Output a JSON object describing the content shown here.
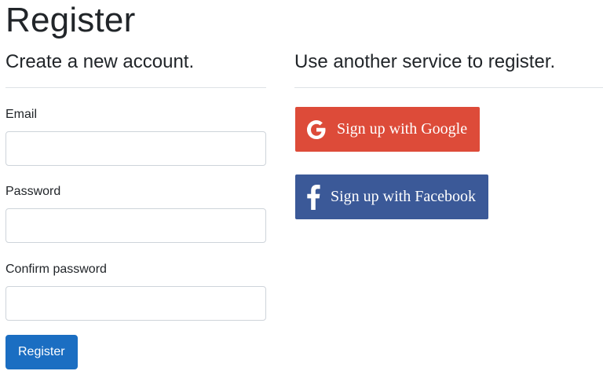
{
  "page": {
    "title": "Register"
  },
  "local_register": {
    "heading": "Create a new account.",
    "email_label": "Email",
    "email_value": "",
    "password_label": "Password",
    "password_value": "",
    "confirm_label": "Confirm password",
    "confirm_value": "",
    "submit_label": "Register"
  },
  "external_register": {
    "heading": "Use another service to register.",
    "google_label": "Sign up with Google",
    "google_icon": "google-g-icon",
    "google_color": "#dd4b39",
    "facebook_label": "Sign up with Facebook",
    "facebook_icon": "facebook-f-icon",
    "facebook_color": "#3b5998"
  },
  "colors": {
    "primary_button": "#1b6ec2",
    "divider": "#dee2e6",
    "input_border": "#ced4da"
  }
}
